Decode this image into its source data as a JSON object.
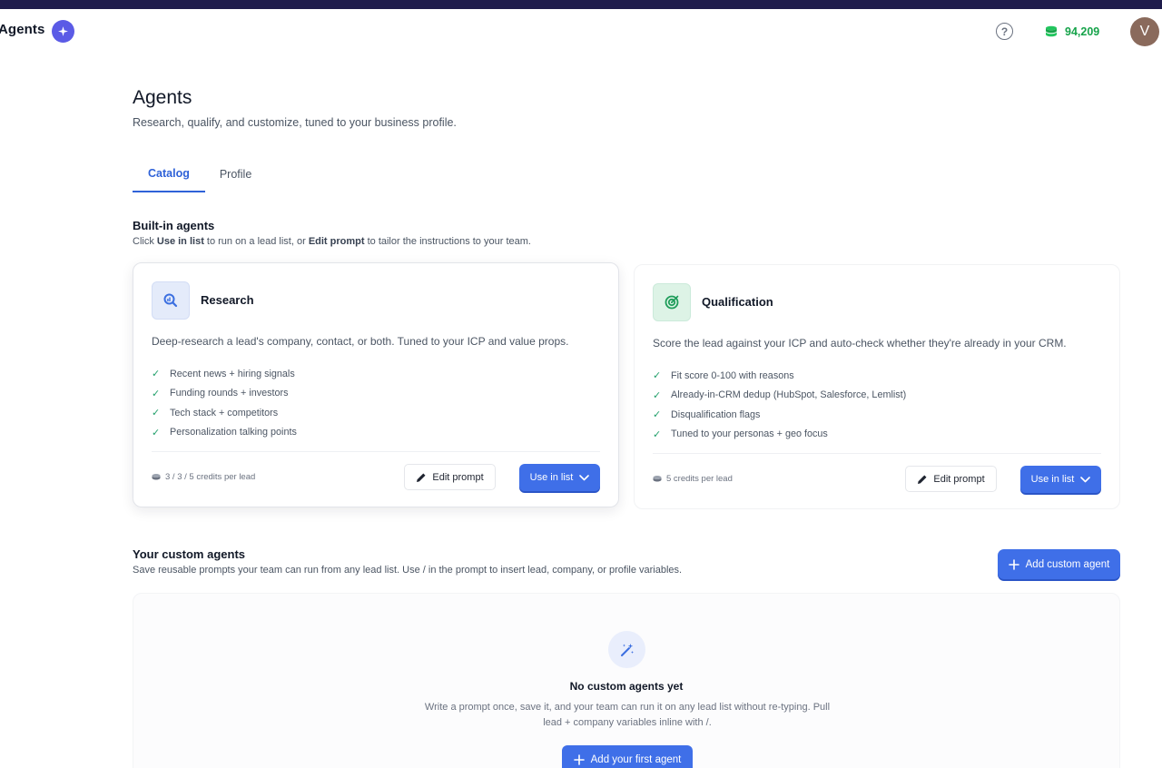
{
  "header": {
    "app_title": "Agents",
    "help_icon": "question-circle-icon",
    "credits_icon": "coins-stack-icon",
    "credits_value": "94,209",
    "avatar_initial": "V"
  },
  "page": {
    "title": "Agents",
    "subtitle": "Research, qualify, and customize, tuned to your business profile."
  },
  "tabs": [
    {
      "label": "Catalog",
      "active": true
    },
    {
      "label": "Profile",
      "active": false
    }
  ],
  "builtin": {
    "title": "Built-in agents",
    "desc_prefix": "Click ",
    "desc_use": "Use in list",
    "desc_mid": " to run on a lead list, or ",
    "desc_edit": "Edit prompt",
    "desc_suffix": " to tailor the instructions to your team.",
    "cards": [
      {
        "title": "Research",
        "icon": "search-chart-icon",
        "description": "Deep-research a lead's company, contact, or both. Tuned to your ICP and value props.",
        "features": [
          "Recent news + hiring signals",
          "Funding rounds + investors",
          "Tech stack + competitors",
          "Personalization talking points"
        ],
        "cost": "3 / 3 / 5 credits per lead",
        "edit_label": "Edit prompt",
        "use_label": "Use in list"
      },
      {
        "title": "Qualification",
        "icon": "target-icon",
        "description": "Score the lead against your ICP and auto-check whether they're already in your CRM.",
        "features": [
          "Fit score 0-100 with reasons",
          "Already-in-CRM dedup (HubSpot, Salesforce, Lemlist)",
          "Disqualification flags",
          "Tuned to your personas + geo focus"
        ],
        "cost": "5 credits per lead",
        "edit_label": "Edit prompt",
        "use_label": "Use in list"
      }
    ]
  },
  "custom": {
    "title": "Your custom agents",
    "desc": "Save reusable prompts your team can run from any lead list. Use / in the prompt to insert lead, company, or profile variables.",
    "add_label": "Add custom agent",
    "empty_icon": "magic-wand-icon",
    "empty_title": "No custom agents yet",
    "empty_desc": "Write a prompt once, save it, and your team can run it on any lead list without re-typing. Pull lead + company variables inline with /.",
    "first_label": "Add your first agent"
  },
  "colors": {
    "accent": "#3f6fe8",
    "tab_active": "#2f62d8",
    "credits": "#16a34a",
    "check": "#22a06b",
    "topbar": "#1e1b4b"
  }
}
